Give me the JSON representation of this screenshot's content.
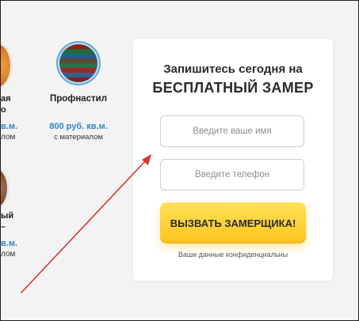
{
  "left_products": [
    {
      "name_fragment": "ая",
      "name_fragment_2": "о",
      "price_fragment": "в.м.",
      "sub_fragment": "лом"
    },
    {
      "name": "Профнастил",
      "price": "800 руб. кв.м.",
      "sub": "с материалом"
    },
    {
      "name_fragment": "ый",
      "name_fragment_2": "–",
      "price_fragment": "в.м.",
      "sub_fragment": "лом"
    }
  ],
  "form": {
    "title": "Запишитесь сегодня на",
    "subtitle": "БЕСПЛАТНЫЙ ЗАМЕР",
    "name_placeholder": "Введите ваше имя",
    "phone_placeholder": "Введите телефон",
    "submit_label": "ВЫЗВАТЬ ЗАМЕРЩИКА!",
    "privacy_note": "Ваши данные конфиденциальны"
  },
  "colors": {
    "accent_blue": "#2e86c9",
    "button_yellow": "#ffd33a",
    "arrow_red": "#d9342b"
  }
}
